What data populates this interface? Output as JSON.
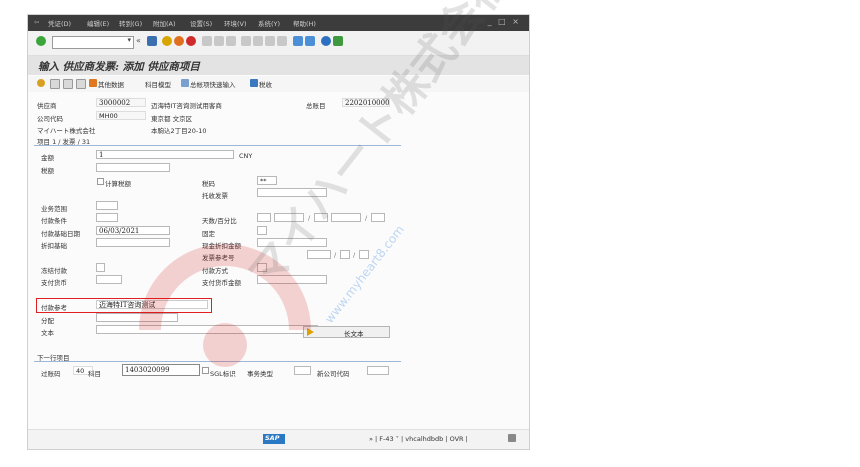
{
  "menu": {
    "items": [
      "凭证(D)",
      "编辑(E)",
      "转到(G)",
      "附加(A)",
      "设置(S)",
      "环境(V)",
      "系统(Y)",
      "帮助(H)"
    ],
    "window_controls": "_ □ ×"
  },
  "toolbar": {
    "command_field": "",
    "back_chevrons": "«"
  },
  "title": "输入 供应商发票: 添加 供应商项目",
  "app_toolbar": {
    "other_data": "其他数据",
    "account_model": "科目模型",
    "fast_entry": "总帐项快速输入",
    "tax": "税收"
  },
  "header": {
    "vendor_label": "供应商",
    "vendor_value": "3000002",
    "vendor_name": "迈海特IT咨询测试用客商",
    "gl_label": "总账目",
    "gl_value": "2202010000",
    "company_label": "公司代码",
    "company_value": "MH00",
    "city": "東京都 文京区",
    "company_name": "マイハート株式会社",
    "street": "本駒込2丁目20-10"
  },
  "item_section": {
    "title": "项目 1 / 发票 / 31",
    "amount_label": "金额",
    "amount_value": "1",
    "currency": "CNY",
    "tax_amount_label": "税额",
    "calc_tax_label": "计算税额",
    "tax_code_label": "税码",
    "tax_code_value": "**",
    "tax_deferred_label": "托收发票",
    "business_area_label": "业务范围",
    "payment_terms_label": "付款条件",
    "days_pct_label": "天数/百分比",
    "baseline_label": "付款基础日期",
    "baseline_value": "06/03/2021",
    "fixed_label": "固定",
    "discount_base_label": "折扣基础",
    "cash_discount_label": "现金折扣金额",
    "invoice_ref_label": "发票参考号",
    "payment_block_label": "冻结付款",
    "payment_method_label": "付款方式",
    "payment_currency_label": "支付货币",
    "payment_currency_amt_label": "支付货币金额",
    "payment_ref_label": "付款参考",
    "payment_ref_value": "迈海特IT咨询测试",
    "assignment_label": "分配",
    "text_label": "文本",
    "long_text_button": "长文本"
  },
  "next_item": {
    "title": "下一行项目",
    "posting_key_label": "过账码",
    "posting_key_value": "40",
    "account_label": "科目",
    "account_value": "1403020099",
    "sgl_label": "SGL标识",
    "trans_type_label": "事务类型",
    "new_company_label": "新公司代码"
  },
  "status_bar": {
    "sap_logo": "SAP",
    "info": "» | F-43 ˅ | vhcalhdbdb | OVR |"
  },
  "colors": {
    "menubar": "#3c3c3c",
    "highlight_frame": "#e02020",
    "section_line": "#9fb7d6"
  }
}
